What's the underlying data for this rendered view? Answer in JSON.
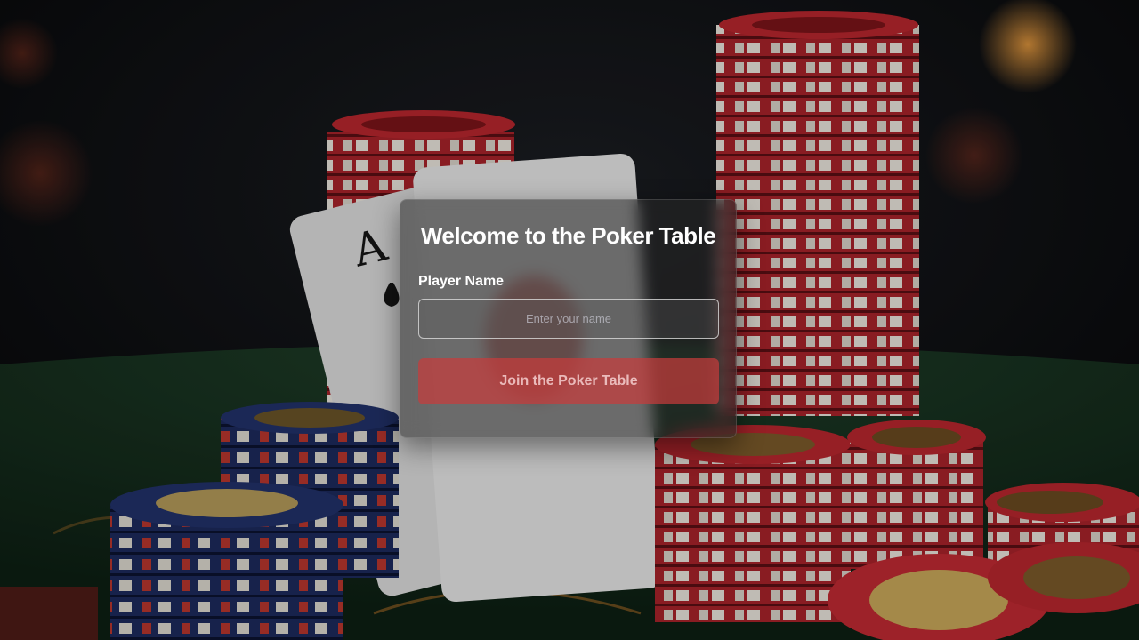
{
  "login": {
    "title": "Welcome to the Poker Table",
    "player_name_label": "Player Name",
    "name_placeholder": "Enter your name",
    "name_value": "",
    "join_button_label": "Join the Poker Table"
  },
  "background": {
    "description_icon": "poker-table-icon",
    "card_rank": "A",
    "colors": {
      "red_chip": "#b3262d",
      "blue_chip": "#1e2c5e",
      "felt": "#16331f",
      "card": "#e8e8e8"
    }
  }
}
